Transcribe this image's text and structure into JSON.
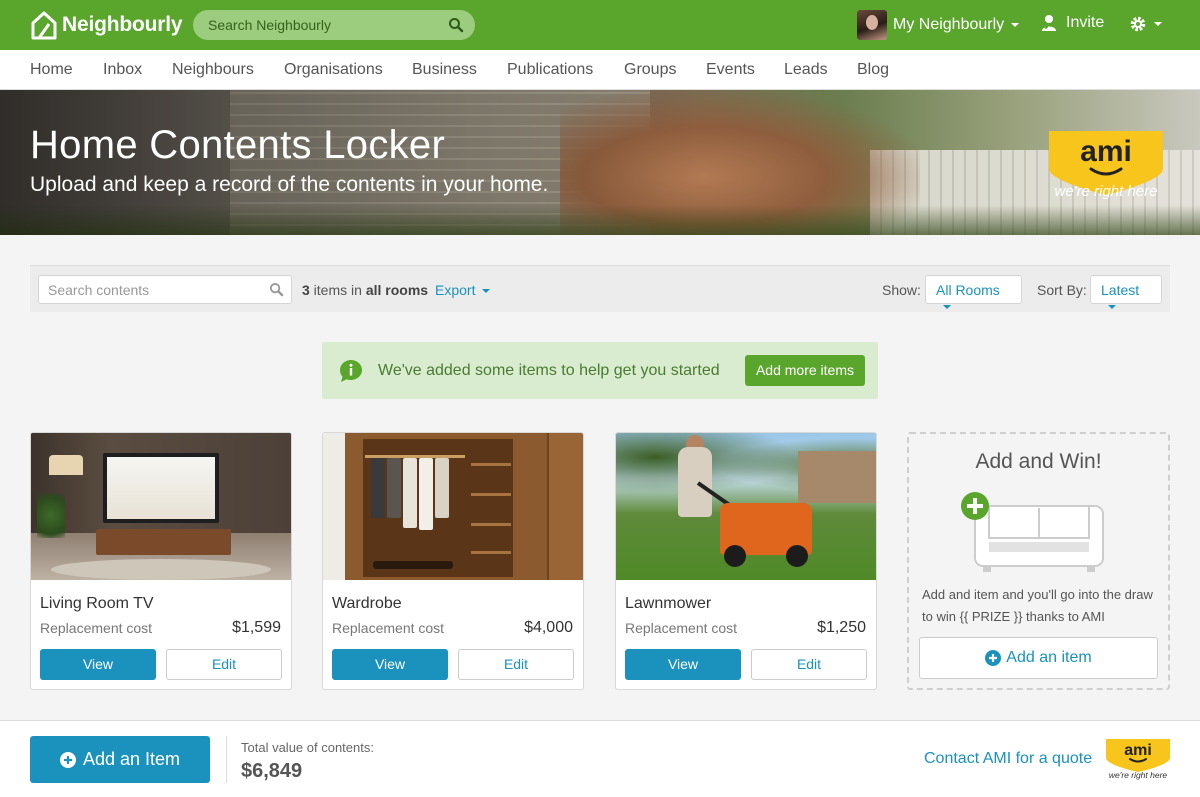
{
  "app": {
    "name": "Neighbourly",
    "search_placeholder": "Search Neighbourly",
    "user_menu": "My Neighbourly",
    "invite": "Invite",
    "accent_color": "#5aa52c",
    "link_color": "#1a92bd"
  },
  "nav": {
    "items": [
      "Home",
      "Inbox",
      "Neighbours",
      "Organisations",
      "Business",
      "Publications",
      "Groups",
      "Events",
      "Leads",
      "Blog"
    ]
  },
  "hero": {
    "title": "Home Contents Locker",
    "subtitle": "Upload and keep a record of the contents in your home.",
    "badge_logo": "ami",
    "badge_tagline": "we're right here"
  },
  "toolbar": {
    "search_placeholder": "Search contents",
    "count": "3",
    "count_mid": " items in ",
    "count_scope": "all rooms",
    "export": "Export",
    "show_label": "Show:",
    "show_value": "All Rooms",
    "sort_label": "Sort By:",
    "sort_value": "Latest"
  },
  "notice": {
    "icon": "info-icon",
    "message": "We've added some items to help get you started",
    "button": "Add more items"
  },
  "items": [
    {
      "name": "Living Room TV",
      "cost_label": "Replacement cost",
      "price": "$1,599",
      "view": "View",
      "edit": "Edit"
    },
    {
      "name": "Wardrobe",
      "cost_label": "Replacement cost",
      "price": "$4,000",
      "view": "View",
      "edit": "Edit"
    },
    {
      "name": "Lawnmower",
      "cost_label": "Replacement cost",
      "price": "$1,250",
      "view": "View",
      "edit": "Edit"
    }
  ],
  "promo": {
    "title": "Add and Win!",
    "text": "Add and item and you'll go into the draw to win {{ PRIZE }} thanks to AMI",
    "button": "Add an item"
  },
  "footer": {
    "add_button": "Add an Item",
    "total_label": "Total value of contents:",
    "total_value": "$6,849",
    "contact": "Contact AMI for a quote",
    "logo": "ami",
    "tagline": "we're right here"
  }
}
